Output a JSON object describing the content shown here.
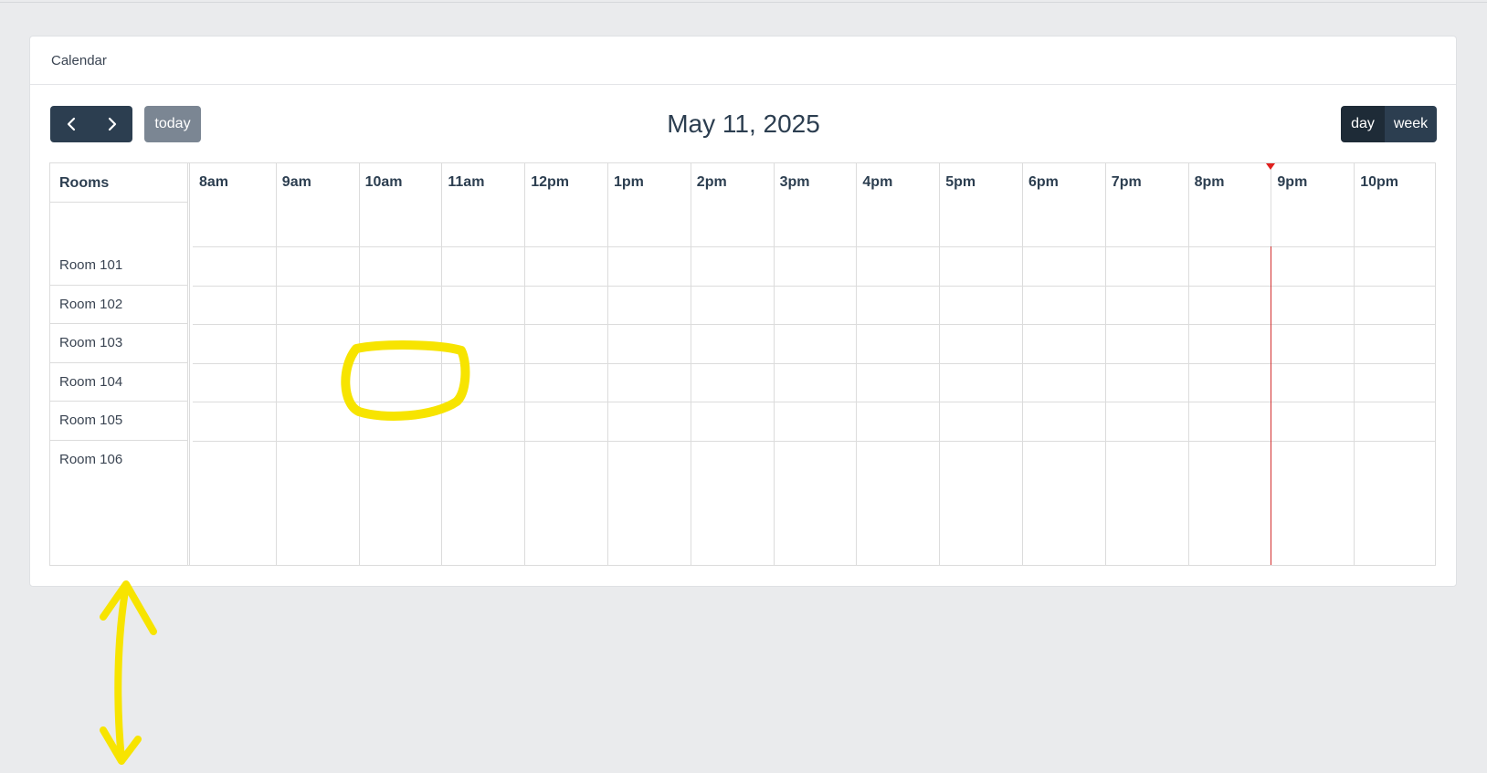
{
  "card": {
    "header_title": "Calendar"
  },
  "toolbar": {
    "prev_icon": "chevron-left-icon",
    "next_icon": "chevron-right-icon",
    "today_label": "today",
    "title": "May 11, 2025",
    "views": [
      "day",
      "week"
    ],
    "active_view": "day"
  },
  "timeline": {
    "resource_header": "Rooms",
    "slots": [
      "8am",
      "9am",
      "10am",
      "11am",
      "12pm",
      "1pm",
      "2pm",
      "3pm",
      "4pm",
      "5pm",
      "6pm",
      "7pm",
      "8pm",
      "9pm",
      "10pm"
    ],
    "resources": [
      "Room 101",
      "Room 102",
      "Room 103",
      "Room 104",
      "Room 105",
      "Room 106"
    ],
    "now_indicator_time": "9pm"
  },
  "colors": {
    "primary": "#2c3e50",
    "active": "#1e2b37",
    "muted_button": "#7b8693",
    "now_indicator": "#d32f2f",
    "annotation": "#f7e400"
  }
}
